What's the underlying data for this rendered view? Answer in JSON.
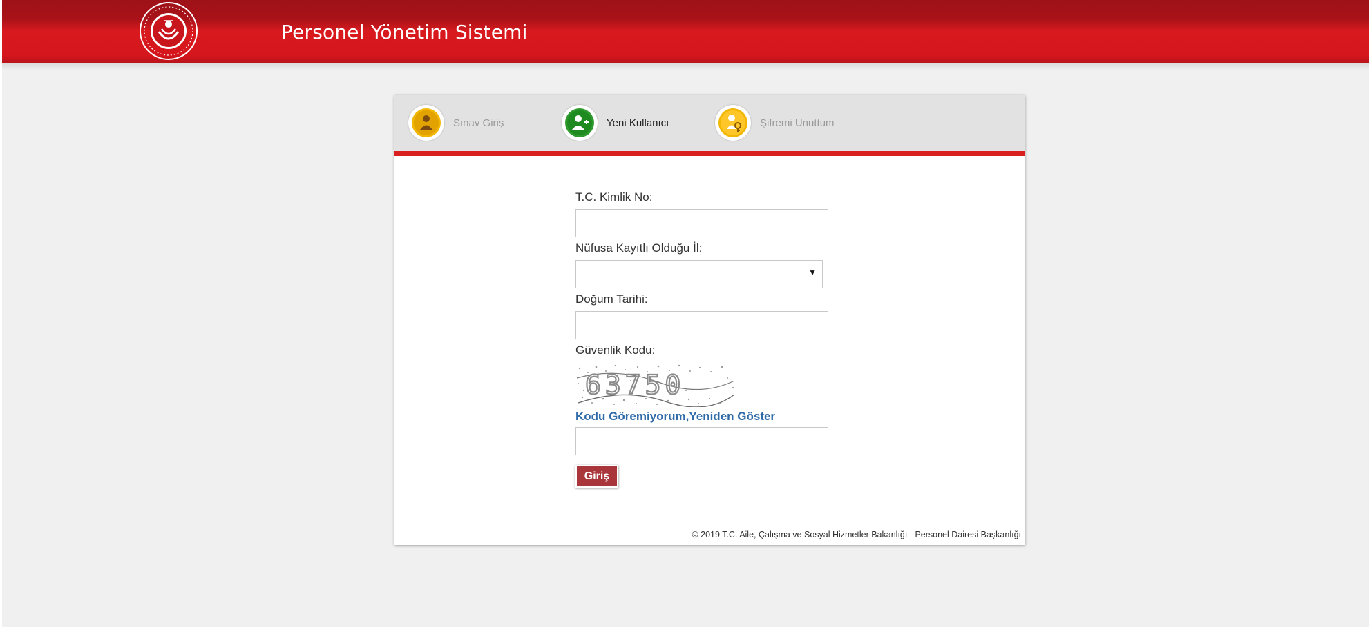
{
  "header": {
    "title": "Personel Yönetim  Sistemi",
    "logo_icon": "ministry-emblem-icon"
  },
  "tabs": [
    {
      "label": "Sınav Giriş",
      "icon": "user-gold-icon",
      "active": false
    },
    {
      "label": "Yeni Kullanıcı",
      "icon": "user-add-green-icon",
      "active": true
    },
    {
      "label": "Şifremi Unuttum",
      "icon": "key-gold-icon",
      "active": false
    }
  ],
  "form": {
    "tc_label": "T.C. Kimlik No:",
    "tc_value": "",
    "city_label": "Nüfusa Kayıtlı Olduğu İl:",
    "city_value": "",
    "birth_label": "Doğum Tarihi:",
    "birth_value": "",
    "security_label": "Güvenlik Kodu:",
    "captcha_text": "63750",
    "refresh_link": "Kodu Göremiyorum,Yeniden Göster",
    "code_value": "",
    "submit_label": "Giriş"
  },
  "footer": {
    "text": "© 2019 T.C. Aile, Çalışma ve Sosyal Hizmetler Bakanlığı - Personel Dairesi Başkanlığı"
  },
  "colors": {
    "header_red": "#d5161c",
    "accent_red": "#d9201f",
    "button": "#a9363b",
    "link": "#2f6ba8",
    "gold": "#f2b705",
    "green": "#2e9a2e"
  }
}
